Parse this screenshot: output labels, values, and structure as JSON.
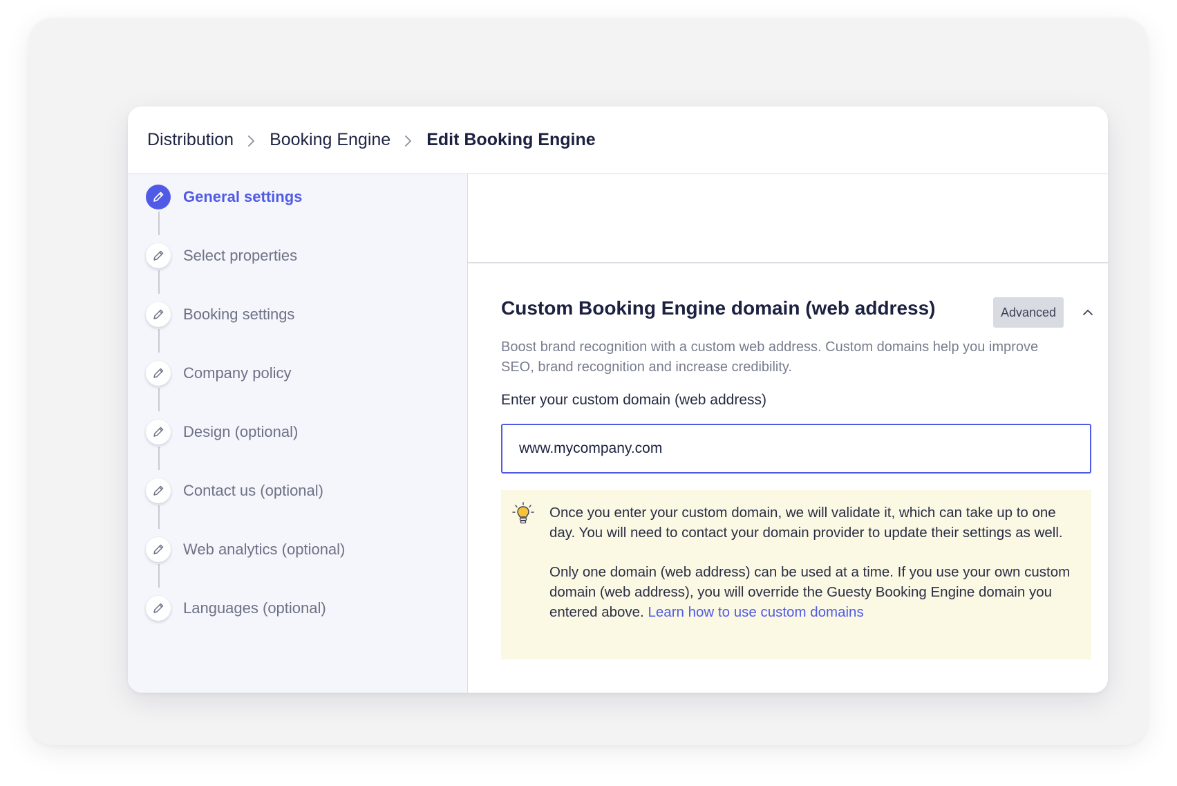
{
  "breadcrumb": [
    {
      "label": "Distribution"
    },
    {
      "label": "Booking Engine"
    },
    {
      "label": "Edit Booking Engine"
    }
  ],
  "sidebar": {
    "steps": [
      {
        "label": "General settings",
        "active": true,
        "icon": "pencil-icon"
      },
      {
        "label": "Select properties",
        "active": false,
        "icon": "pencil-icon"
      },
      {
        "label": "Booking settings",
        "active": false,
        "icon": "pencil-icon"
      },
      {
        "label": "Company policy",
        "active": false,
        "icon": "pencil-icon"
      },
      {
        "label": "Design (optional)",
        "active": false,
        "icon": "pencil-icon"
      },
      {
        "label": "Contact us (optional)",
        "active": false,
        "icon": "pencil-icon"
      },
      {
        "label": "Web analytics (optional)",
        "active": false,
        "icon": "pencil-icon"
      },
      {
        "label": "Languages (optional)",
        "active": false,
        "icon": "pencil-icon"
      }
    ]
  },
  "section": {
    "title": "Custom Booking Engine domain (web address)",
    "badge": "Advanced",
    "collapse_icon": "chevron-up-icon",
    "description": "Boost brand recognition with a custom web address. Custom domains help you improve SEO, brand recognition and increase credibility.",
    "field_label": "Enter your custom domain (web address)",
    "domain_value": "www.mycompany.com"
  },
  "info": {
    "icon": "lightbulb-icon",
    "paragraph1": "Once you enter your custom domain, we will validate it, which can take up to one day. You will need to contact your domain provider to update their settings as well.",
    "paragraph2": "Only one domain (web address) can be used at a time. If you use your own custom domain (web address), you will override the Guesty Booking Engine domain you entered above.",
    "link_label": "Learn how to use custom domains"
  },
  "colors": {
    "accent": "#4f5be6",
    "info_bg": "#fbf8e4",
    "sidebar_bg": "#f5f6fb",
    "title": "#1c2140"
  }
}
